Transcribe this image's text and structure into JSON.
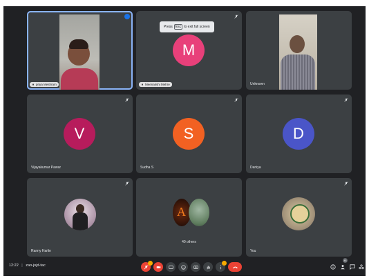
{
  "toast": {
    "prefix": "Press",
    "key": "Esc",
    "suffix": "to exit full screen"
  },
  "participants": [
    {
      "name": "priya Meshram",
      "type": "video"
    },
    {
      "name": "Meenakshi Mehre",
      "type": "avatar",
      "initial": "M",
      "color": "#e8407a"
    },
    {
      "name": "Unknown",
      "type": "video"
    },
    {
      "name": "Vijayakumar Pawar",
      "type": "avatar",
      "initial": "V",
      "color": "#b71c5c"
    },
    {
      "name": "Sudha S",
      "type": "avatar",
      "initial": "S",
      "color": "#f26122"
    },
    {
      "name": "Daniya",
      "type": "avatar",
      "initial": "D",
      "color": "#4a55c8"
    },
    {
      "name": "Ranny Harlin",
      "type": "photo"
    },
    {
      "name": "40 others",
      "type": "group"
    },
    {
      "name": "You",
      "type": "photo"
    }
  ],
  "bottom_bar": {
    "time": "12:22",
    "separator": "|",
    "meeting_code": "zao-jojd-tac",
    "participants_count": "48"
  },
  "colors": {
    "background": "#202124",
    "tile": "#3c4043",
    "end_call": "#ea4335",
    "active_outline": "#8ab4f8"
  }
}
